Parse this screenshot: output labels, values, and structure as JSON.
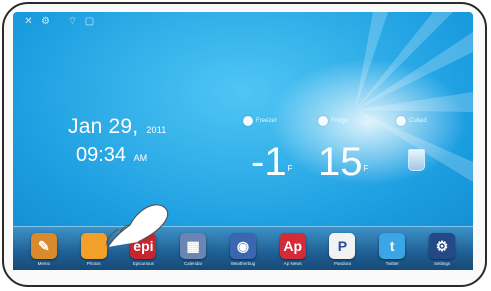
{
  "date": {
    "text": "Jan 29,",
    "year": "2011"
  },
  "time": {
    "text": "09:34",
    "ampm": "AM"
  },
  "weather": {
    "freezer": {
      "label": "Freezer",
      "temp": "-1",
      "unit": "F"
    },
    "fridge": {
      "label": "Fridge",
      "temp": "15",
      "unit": "F"
    },
    "cubed": {
      "label": "Cubed"
    }
  },
  "status_icons": [
    "close-icon",
    "settings-icon",
    "wifi-icon",
    "lock-icon"
  ],
  "apps": [
    {
      "label": "Memo",
      "icon": "memo-icon",
      "color": "#d98a2c",
      "glyph": "✎"
    },
    {
      "label": "Photos",
      "icon": "photos-icon",
      "color": "#f3a02a",
      "glyph": ""
    },
    {
      "label": "Epicurious",
      "icon": "epicurious-icon",
      "color": "#c3262f",
      "glyph": "epi"
    },
    {
      "label": "Calendar",
      "icon": "calendar-icon",
      "color": "#6b86b5",
      "glyph": "▦"
    },
    {
      "label": "Weatherbug",
      "icon": "weatherbug-icon",
      "color": "#3b66b0",
      "glyph": "◉"
    },
    {
      "label": "Ap News",
      "icon": "ap-news-icon",
      "color": "#d42b3b",
      "glyph": "Ap"
    },
    {
      "label": "Pandora",
      "icon": "pandora-icon",
      "color": "#f2f2f2",
      "glyph": "P"
    },
    {
      "label": "Twitter",
      "icon": "twitter-icon",
      "color": "#3aa6e6",
      "glyph": "t"
    },
    {
      "label": "Settings",
      "icon": "settings-icon",
      "color": "#234a86",
      "glyph": "⚙"
    }
  ]
}
